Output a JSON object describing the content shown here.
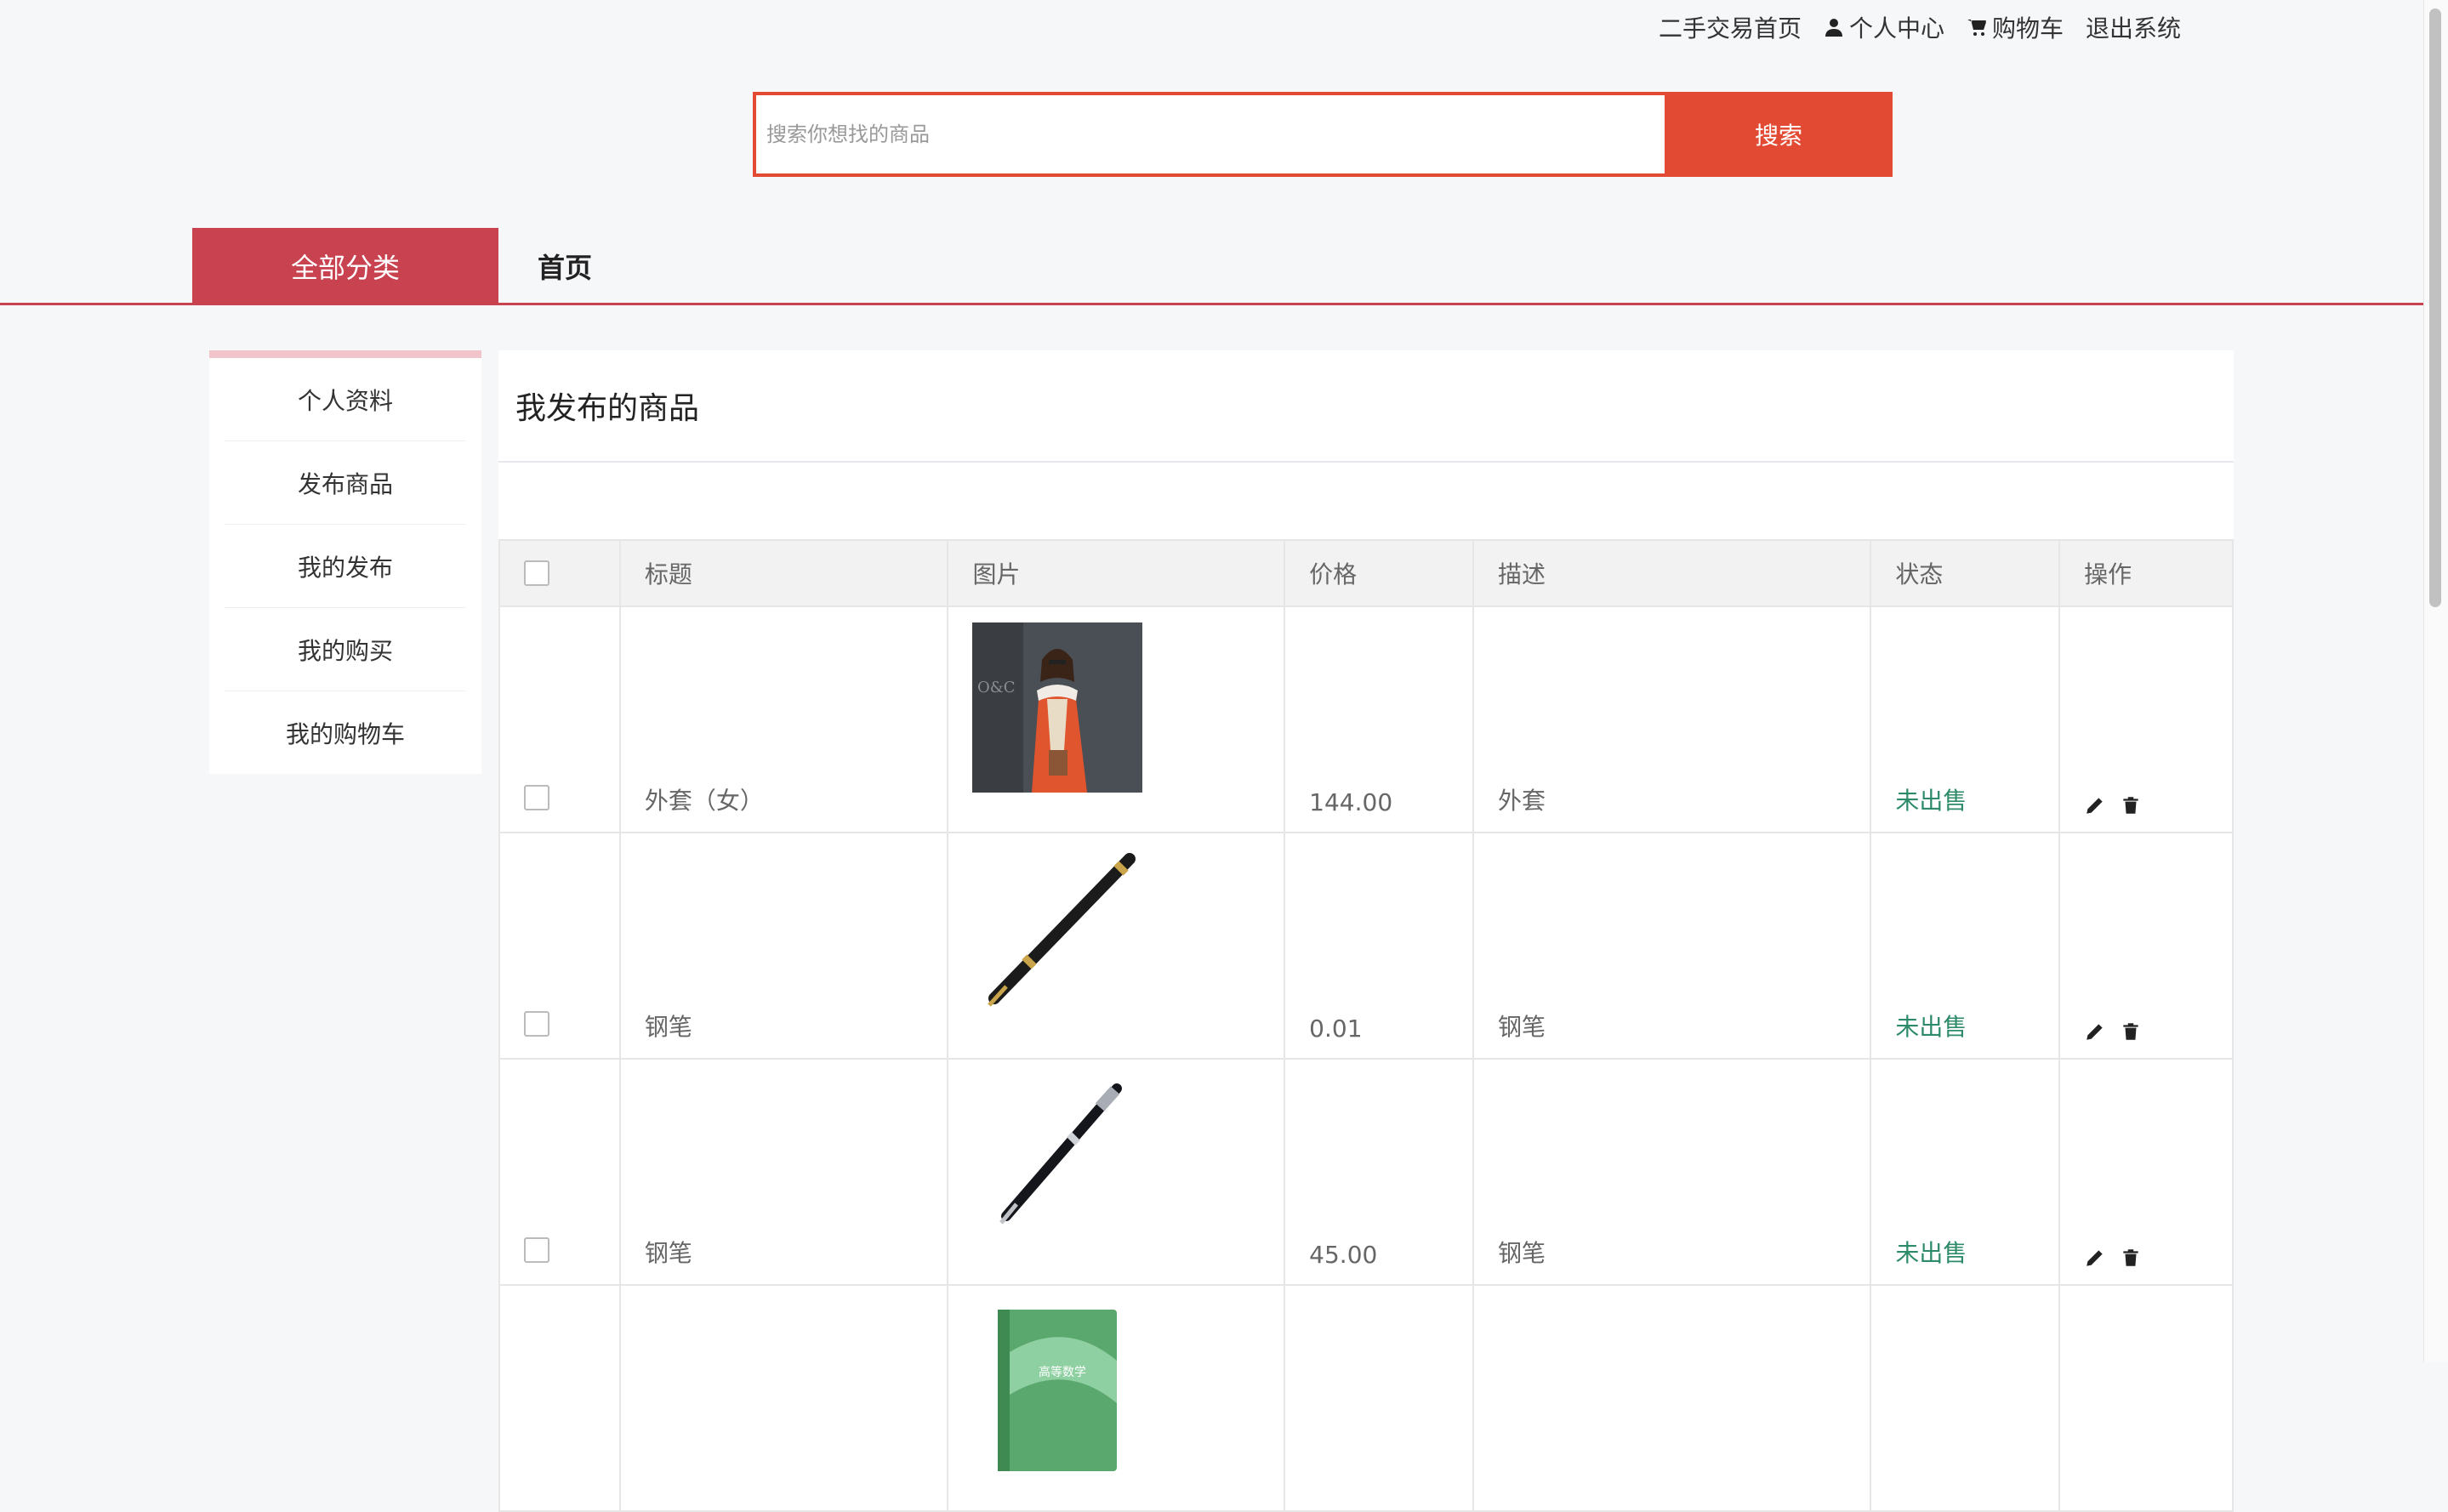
{
  "header": {
    "links": [
      {
        "label": "二手交易首页",
        "icon": ""
      },
      {
        "label": "个人中心",
        "icon": "user-icon"
      },
      {
        "label": "购物车",
        "icon": "cart-icon"
      },
      {
        "label": "退出系统",
        "icon": ""
      }
    ]
  },
  "search": {
    "placeholder": "搜索你想找的商品",
    "button_label": "搜索"
  },
  "nav": {
    "all_categories": "全部分类",
    "home": "首页"
  },
  "sidebar": {
    "items": [
      {
        "label": "个人资料"
      },
      {
        "label": "发布商品"
      },
      {
        "label": "我的发布"
      },
      {
        "label": "我的购买"
      },
      {
        "label": "我的购物车"
      }
    ]
  },
  "main": {
    "title": "我发布的商品",
    "columns": [
      "",
      "标题",
      "图片",
      "价格",
      "描述",
      "状态",
      "操作"
    ],
    "rows": [
      {
        "title": "外套（女）",
        "image": "coat-photo",
        "price": "144.00",
        "desc": "外套",
        "status": "未出售"
      },
      {
        "title": "钢笔",
        "image": "pen-photo",
        "price": "0.01",
        "desc": "钢笔",
        "status": "未出售"
      },
      {
        "title": "钢笔",
        "image": "pen-photo",
        "price": "45.00",
        "desc": "钢笔",
        "status": "未出售"
      },
      {
        "title": "",
        "image": "book-photo",
        "price": "",
        "desc": "",
        "status": "",
        "book_title": "高等数学"
      }
    ]
  },
  "colors": {
    "accent": "#c8424f",
    "search": "#e24a33",
    "status_green": "#2e8b6a"
  }
}
